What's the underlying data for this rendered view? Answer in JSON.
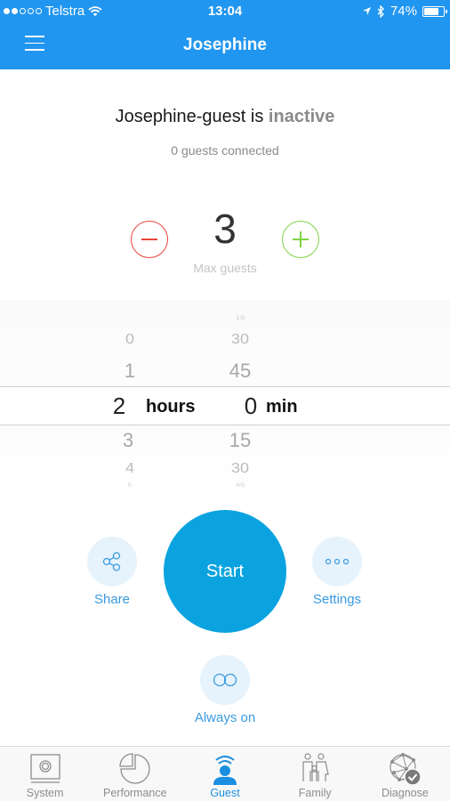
{
  "status_bar": {
    "carrier": "Telstra",
    "signal_bars_filled": 2,
    "signal_bars_total": 5,
    "time": "13:04",
    "battery_percent_label": "74%",
    "battery_level": 0.74
  },
  "nav": {
    "title": "Josephine",
    "menu_icon": "hamburger-icon"
  },
  "network_status": {
    "network_name_prefix": "Josephine-guest is ",
    "state": "inactive",
    "guests_connected": "0 guests connected"
  },
  "max_guests": {
    "value": "3",
    "label": "Max guests",
    "decrement_icon": "minus-circle-icon",
    "increment_icon": "plus-circle-icon"
  },
  "duration_picker": {
    "hours": {
      "above": [
        "0",
        "1"
      ],
      "selected": "2",
      "below": [
        "3",
        "4",
        "5"
      ],
      "unit": "hours"
    },
    "minutes": {
      "above": [
        "15",
        "30",
        "45"
      ],
      "selected": "0",
      "below": [
        "15",
        "30",
        "45"
      ],
      "unit": "min"
    }
  },
  "actions": {
    "start": "Start",
    "share": "Share",
    "settings": "Settings",
    "always_on": "Always on"
  },
  "tabs": [
    {
      "label": "System",
      "icon": "router-icon",
      "active": false
    },
    {
      "label": "Performance",
      "icon": "pie-chart-icon",
      "active": false
    },
    {
      "label": "Guest",
      "icon": "guest-wifi-icon",
      "active": true
    },
    {
      "label": "Family",
      "icon": "family-icon",
      "active": false
    },
    {
      "label": "Diagnose",
      "icon": "network-check-icon",
      "active": false
    }
  ],
  "colors": {
    "primary": "#2196f0",
    "start_button": "#0aa3e0",
    "decrement": "#e8453c",
    "increment": "#7ed348",
    "action_label": "#3a9be0",
    "active_tab": "#1a8fe0"
  }
}
